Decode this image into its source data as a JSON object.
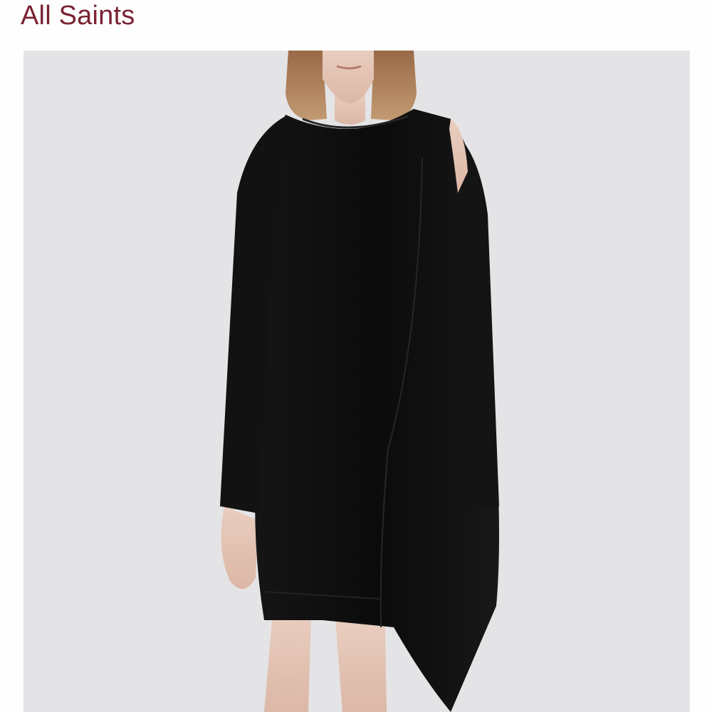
{
  "header": {
    "brand_label": "All Saints"
  },
  "product_image": {
    "subject": "model-wearing-black-dress",
    "background_color": "#e4e4e6",
    "garment_color": "#0d0d0d",
    "accent_color": "#7a2233"
  }
}
